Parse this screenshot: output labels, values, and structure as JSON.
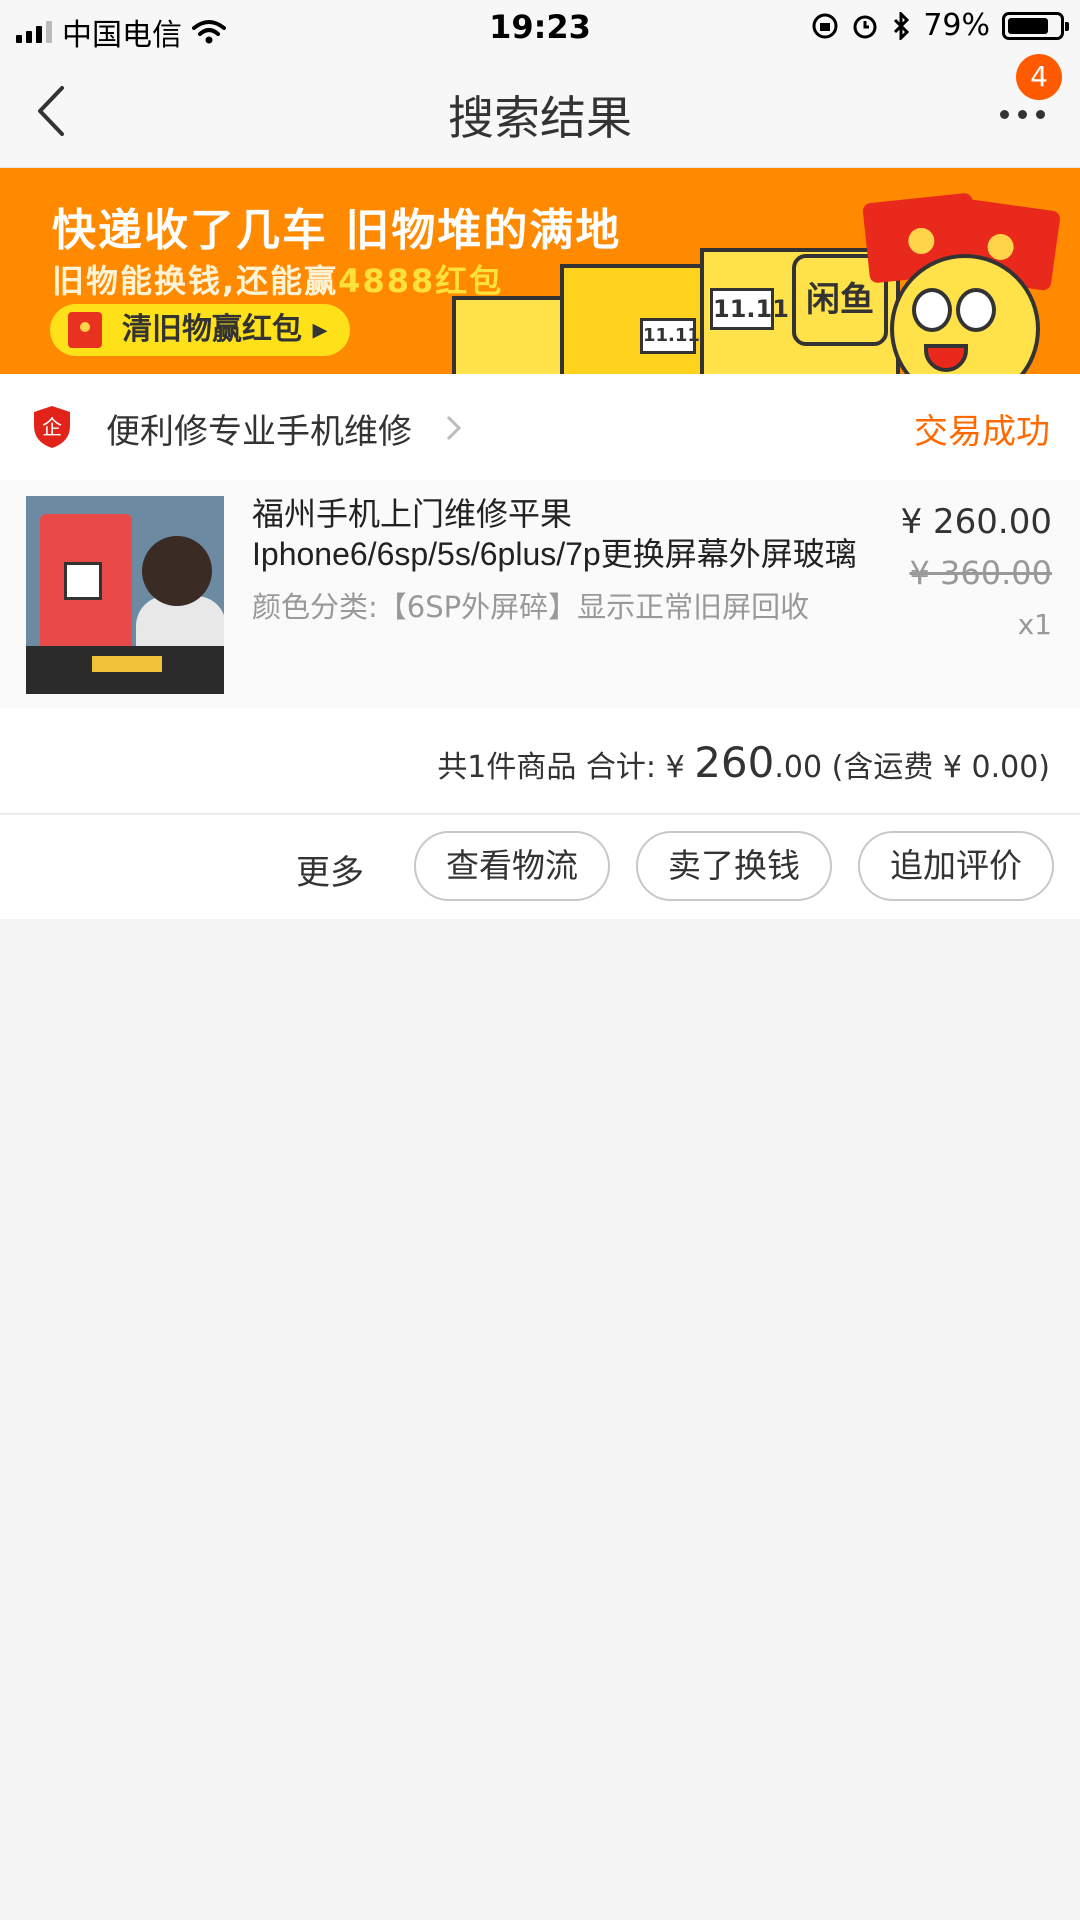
{
  "status_bar": {
    "carrier": "中国电信",
    "time": "19:23",
    "battery": "79%",
    "battery_level": 0.79
  },
  "nav": {
    "title": "搜索结果",
    "badge_count": "4"
  },
  "banner": {
    "line1": "快递收了几车 旧物堆的满地",
    "line2_prefix": "旧物能换钱,还能赢",
    "line2_highlight": "4888红包",
    "button_label": "清旧物赢红包",
    "tag_small": "11.11",
    "tag_large": "11.11",
    "sign_text": "闲鱼"
  },
  "shop": {
    "badge_char": "企",
    "name": "便利修专业手机维修",
    "status": "交易成功"
  },
  "product": {
    "title": "福州手机上门维修平果Iphone6/6sp/5s/6plus/7p更换屏幕外屏玻璃",
    "spec": "颜色分类:【6SP外屏碎】显示正常旧屏回收",
    "price": "¥ 260.00",
    "original_price": "¥ 360.00",
    "quantity": "x1"
  },
  "summary": {
    "prefix": "共1件商品 合计: ¥ ",
    "amount_int": "260",
    "amount_dec": ".00",
    "shipping": " (含运费 ¥ 0.00)"
  },
  "actions": {
    "more": "更多",
    "logistics": "查看物流",
    "sell": "卖了换钱",
    "review": "追加评价"
  }
}
